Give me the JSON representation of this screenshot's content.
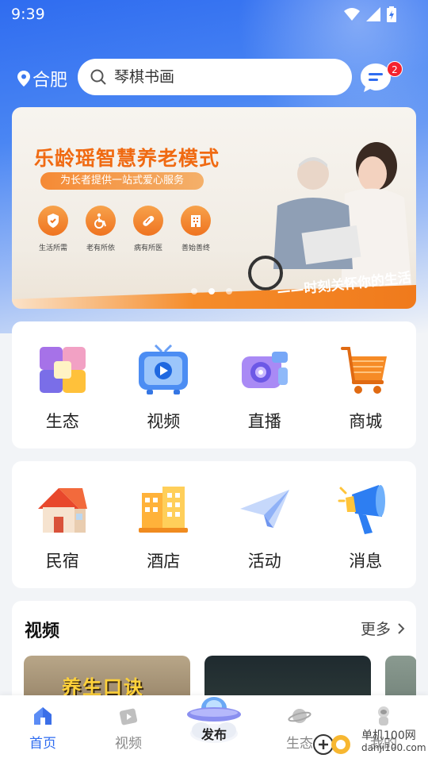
{
  "status_bar": {
    "time": "9:39"
  },
  "header": {
    "location": "合肥",
    "search_placeholder": "琴棋书画",
    "message_badge": "2"
  },
  "banner": {
    "title": "乐龄瑶智慧养老模式",
    "subtitle": "为长者提供一站式爱心服务",
    "icons": [
      {
        "icon": "shield-hand-icon",
        "label": "生活所需"
      },
      {
        "icon": "wheelchair-icon",
        "label": "老有所依"
      },
      {
        "icon": "pill-icon",
        "label": "病有所医"
      },
      {
        "icon": "building-icon",
        "label": "善始善终"
      }
    ],
    "slogan": "——时刻关怀你的生活",
    "active_slide": 2,
    "slide_count": 3
  },
  "grid_row1": [
    {
      "label": "生态",
      "icon": "cube-icon"
    },
    {
      "label": "视频",
      "icon": "tv-icon"
    },
    {
      "label": "直播",
      "icon": "camera-icon"
    },
    {
      "label": "商城",
      "icon": "shopping-cart-icon"
    }
  ],
  "grid_row2": [
    {
      "label": "民宿",
      "icon": "house-icon"
    },
    {
      "label": "酒店",
      "icon": "hotel-icon"
    },
    {
      "label": "活动",
      "icon": "paper-plane-icon"
    },
    {
      "label": "消息",
      "icon": "megaphone-icon"
    }
  ],
  "video_section": {
    "title": "视频",
    "more": "更多",
    "thumbs": [
      {
        "text": "养生口诀"
      },
      {
        "text": ""
      },
      {
        "text": ""
      }
    ]
  },
  "bottom_nav": {
    "items": [
      {
        "label": "首页",
        "icon": "home-icon",
        "active": true
      },
      {
        "label": "视频",
        "icon": "video-icon",
        "active": false
      },
      {
        "label": "发布",
        "icon": "ufo-icon",
        "active": false
      },
      {
        "label": "生态",
        "icon": "planet-icon",
        "active": false
      },
      {
        "label": "我的",
        "icon": "astronaut-icon",
        "active": false
      }
    ]
  },
  "watermark": {
    "line1": "单机100网",
    "line2": "danji100.com"
  },
  "colors": {
    "accent": "#2f6cf0",
    "badge": "#f5222d",
    "banner_orange": "#f06a12"
  }
}
